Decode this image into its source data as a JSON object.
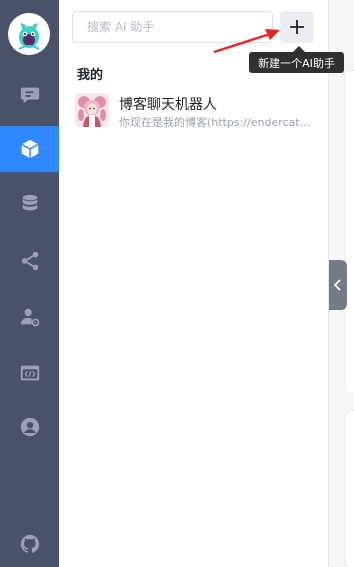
{
  "sidebar": {
    "items": [
      {
        "name": "chat",
        "icon": "chat-bubble-icon",
        "active": false
      },
      {
        "name": "apps",
        "icon": "cube-icon",
        "active": true
      },
      {
        "name": "knowledge-base",
        "icon": "database-icon",
        "active": false
      },
      {
        "name": "share",
        "icon": "share-icon",
        "active": false
      },
      {
        "name": "account",
        "icon": "user-settings-icon",
        "active": false
      },
      {
        "name": "plugins",
        "icon": "code-window-icon",
        "active": false
      },
      {
        "name": "profile",
        "icon": "user-circle-icon",
        "active": false
      },
      {
        "name": "github",
        "icon": "github-icon",
        "active": false
      }
    ]
  },
  "search": {
    "placeholder": "搜索 AI 助手"
  },
  "toolbar": {
    "add_tooltip": "新建一个AI助手"
  },
  "section": {
    "title": "我的"
  },
  "apps": [
    {
      "name": "博客聊天机器人",
      "description": "你现在是我的博客(https://endercat..."
    }
  ],
  "colors": {
    "rail_bg": "#4a5269",
    "rail_active": "#2f88ff",
    "annotation_arrow": "#e8262a",
    "tooltip_bg": "#2f3032"
  }
}
